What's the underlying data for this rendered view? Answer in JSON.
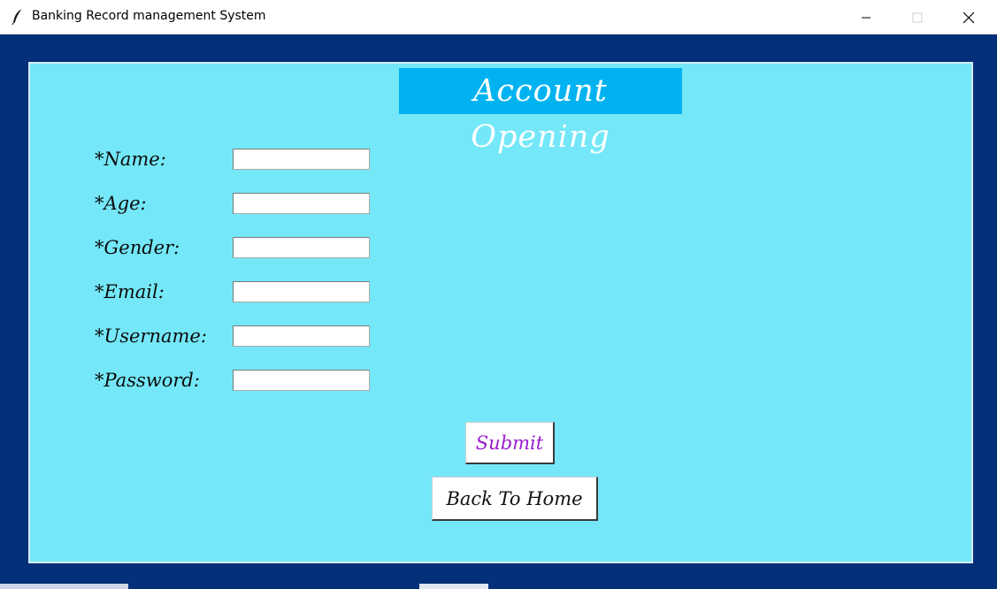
{
  "window": {
    "title": "Banking Record management System",
    "icon": "feather-icon"
  },
  "form": {
    "heading": "Account Opening",
    "fields": [
      {
        "label": "*Name:",
        "value": ""
      },
      {
        "label": "*Age:",
        "value": ""
      },
      {
        "label": "*Gender:",
        "value": ""
      },
      {
        "label": "*Email:",
        "value": ""
      },
      {
        "label": "*Username:",
        "value": ""
      },
      {
        "label": "*Password:",
        "value": ""
      }
    ],
    "submit_label": "Submit",
    "back_label": "Back To Home"
  },
  "colors": {
    "frame": "#042f79",
    "panel": "#74e8f8",
    "heading_bg": "#00b3f0",
    "submit_text": "#9a1ccf"
  }
}
